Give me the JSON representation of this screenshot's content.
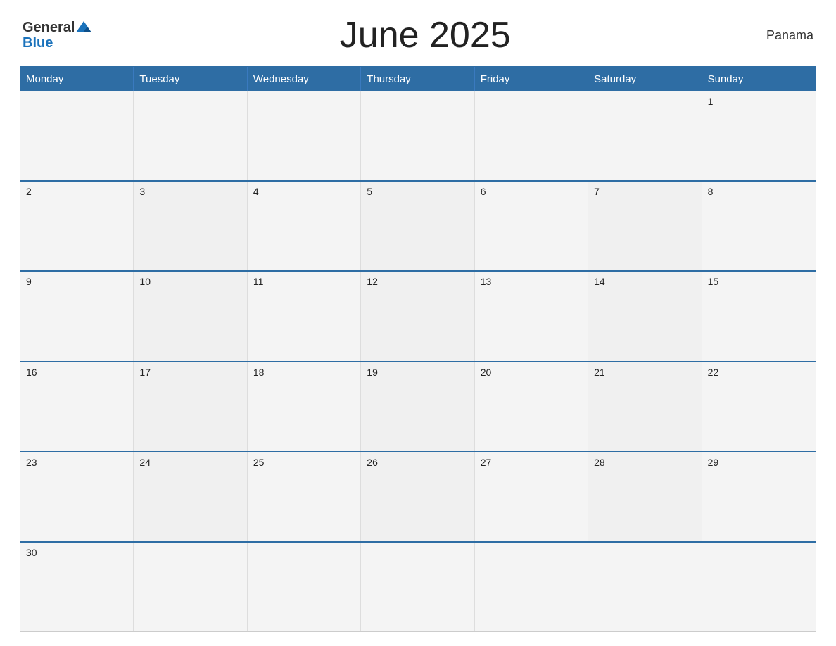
{
  "header": {
    "title": "June 2025",
    "country": "Panama",
    "logo": {
      "general": "General",
      "blue": "Blue"
    }
  },
  "calendar": {
    "days_of_week": [
      "Monday",
      "Tuesday",
      "Wednesday",
      "Thursday",
      "Friday",
      "Saturday",
      "Sunday"
    ],
    "weeks": [
      [
        {
          "day": "",
          "empty": true
        },
        {
          "day": "",
          "empty": true
        },
        {
          "day": "",
          "empty": true
        },
        {
          "day": "",
          "empty": true
        },
        {
          "day": "",
          "empty": true
        },
        {
          "day": "",
          "empty": true
        },
        {
          "day": "1",
          "empty": false
        }
      ],
      [
        {
          "day": "2",
          "empty": false
        },
        {
          "day": "3",
          "empty": false
        },
        {
          "day": "4",
          "empty": false
        },
        {
          "day": "5",
          "empty": false
        },
        {
          "day": "6",
          "empty": false
        },
        {
          "day": "7",
          "empty": false
        },
        {
          "day": "8",
          "empty": false
        }
      ],
      [
        {
          "day": "9",
          "empty": false
        },
        {
          "day": "10",
          "empty": false
        },
        {
          "day": "11",
          "empty": false
        },
        {
          "day": "12",
          "empty": false
        },
        {
          "day": "13",
          "empty": false
        },
        {
          "day": "14",
          "empty": false
        },
        {
          "day": "15",
          "empty": false
        }
      ],
      [
        {
          "day": "16",
          "empty": false
        },
        {
          "day": "17",
          "empty": false
        },
        {
          "day": "18",
          "empty": false
        },
        {
          "day": "19",
          "empty": false
        },
        {
          "day": "20",
          "empty": false
        },
        {
          "day": "21",
          "empty": false
        },
        {
          "day": "22",
          "empty": false
        }
      ],
      [
        {
          "day": "23",
          "empty": false
        },
        {
          "day": "24",
          "empty": false
        },
        {
          "day": "25",
          "empty": false
        },
        {
          "day": "26",
          "empty": false
        },
        {
          "day": "27",
          "empty": false
        },
        {
          "day": "28",
          "empty": false
        },
        {
          "day": "29",
          "empty": false
        }
      ],
      [
        {
          "day": "30",
          "empty": false
        },
        {
          "day": "",
          "empty": true
        },
        {
          "day": "",
          "empty": true
        },
        {
          "day": "",
          "empty": true
        },
        {
          "day": "",
          "empty": true
        },
        {
          "day": "",
          "empty": true
        },
        {
          "day": "",
          "empty": true
        }
      ]
    ]
  }
}
